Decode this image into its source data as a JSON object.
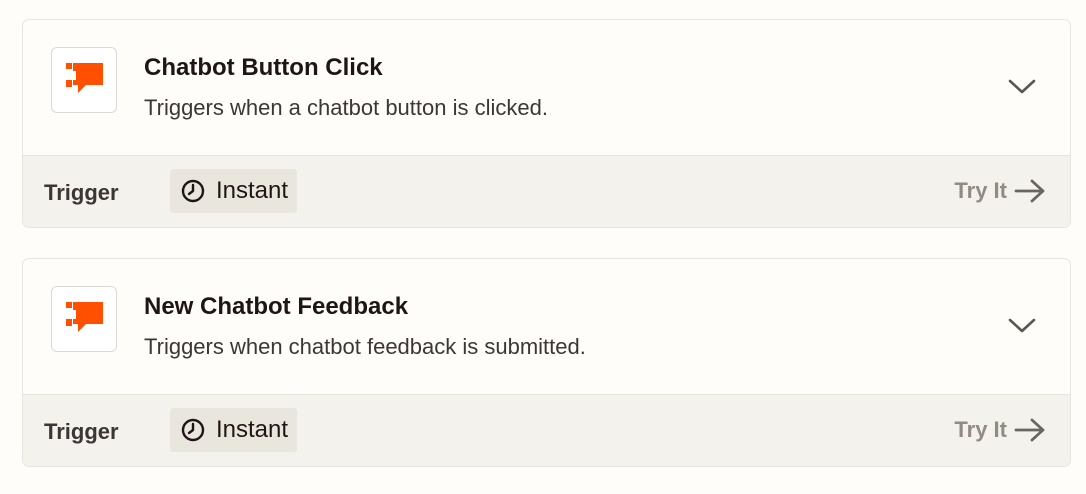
{
  "colors": {
    "brand": "#ff4f00",
    "background": "#fffdf9",
    "footer_bg": "#f3f2ec",
    "badge_bg": "#e8e6dd",
    "muted": "#918b84"
  },
  "cards": [
    {
      "app_icon": "chatbot-logo-icon",
      "title": "Chatbot Button Click",
      "description": "Triggers when a chatbot button is clicked.",
      "expand_icon": "chevron-down-icon",
      "type_label": "Trigger",
      "badge": {
        "icon": "clock-icon",
        "text": "Instant"
      },
      "action": {
        "label": "Try It",
        "icon": "arrow-right-icon"
      }
    },
    {
      "app_icon": "chatbot-logo-icon",
      "title": "New Chatbot Feedback",
      "description": "Triggers when chatbot feedback is submitted.",
      "expand_icon": "chevron-down-icon",
      "type_label": "Trigger",
      "badge": {
        "icon": "clock-icon",
        "text": "Instant"
      },
      "action": {
        "label": "Try It",
        "icon": "arrow-right-icon"
      }
    }
  ]
}
